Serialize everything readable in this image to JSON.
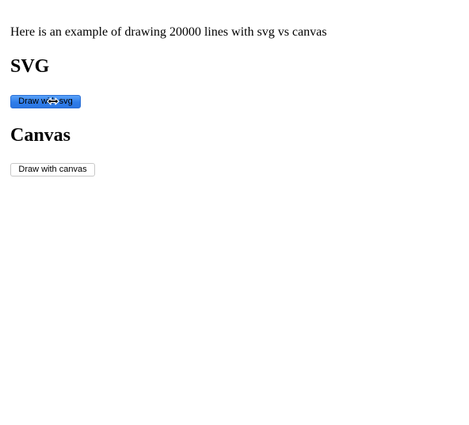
{
  "intro": "Here is an example of drawing 20000 lines with svg vs canvas",
  "sections": {
    "svg": {
      "heading": "SVG",
      "button_label": "Draw with svg"
    },
    "canvas": {
      "heading": "Canvas",
      "button_label": "Draw with canvas"
    }
  },
  "cursor": {
    "icon": "horizontal-resize-cursor-icon"
  },
  "colors": {
    "active_button": "#2f7de9",
    "page_background": "#ffffff"
  }
}
